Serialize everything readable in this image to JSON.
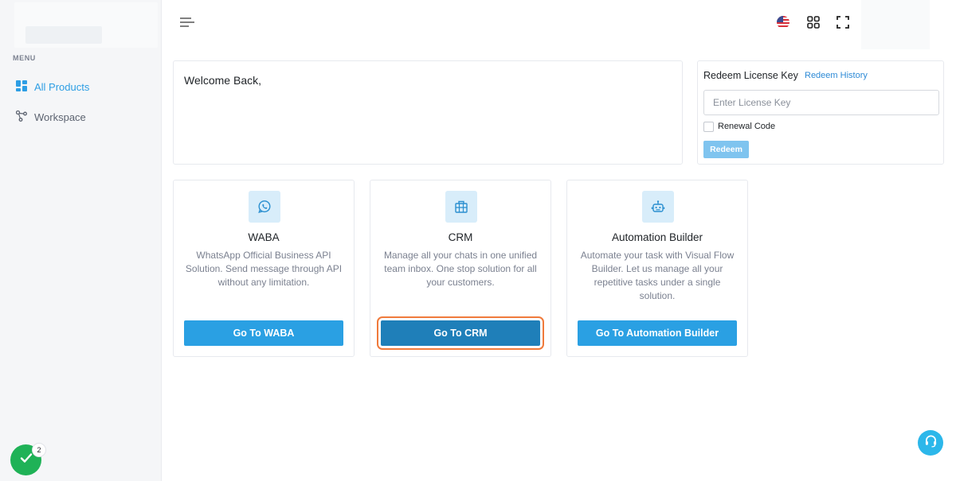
{
  "sidebar": {
    "menu_title": "MENU",
    "items": [
      {
        "label": "All Products",
        "icon": "grid-icon",
        "active": true
      },
      {
        "label": "Workspace",
        "icon": "network-icon",
        "active": false
      }
    ]
  },
  "topbar": {
    "icons": [
      "menu-icon",
      "us-flag-icon",
      "apps-grid-icon",
      "fullscreen-icon"
    ]
  },
  "welcome": {
    "text": "Welcome Back,"
  },
  "redeem": {
    "title": "Redeem License Key",
    "history_link": "Redeem History",
    "input_placeholder": "Enter License Key",
    "input_value": "",
    "checkbox_label": "Renewal Code",
    "checkbox_checked": false,
    "button_label": "Redeem"
  },
  "products": [
    {
      "name": "WABA",
      "description": "WhatsApp Official Business API Solution. Send message through API without any limitation.",
      "button": "Go To WABA",
      "icon": "whatsapp-icon"
    },
    {
      "name": "CRM",
      "description": "Manage all your chats in one unified team inbox. One stop solution for all your customers.",
      "button": "Go To CRM",
      "icon": "building-icon"
    },
    {
      "name": "Automation Builder",
      "description": "Automate your task with Visual Flow Builder. Let us manage all your repetitive tasks under a single solution.",
      "button": "Go To Automation Builder",
      "icon": "robot-icon"
    }
  ],
  "notifications": {
    "badge_count": "2"
  },
  "colors": {
    "accent": "#2aa0e3",
    "active_nav": "#2d9ee4",
    "success": "#1fb257",
    "focus_ring": "#f07a3b"
  }
}
